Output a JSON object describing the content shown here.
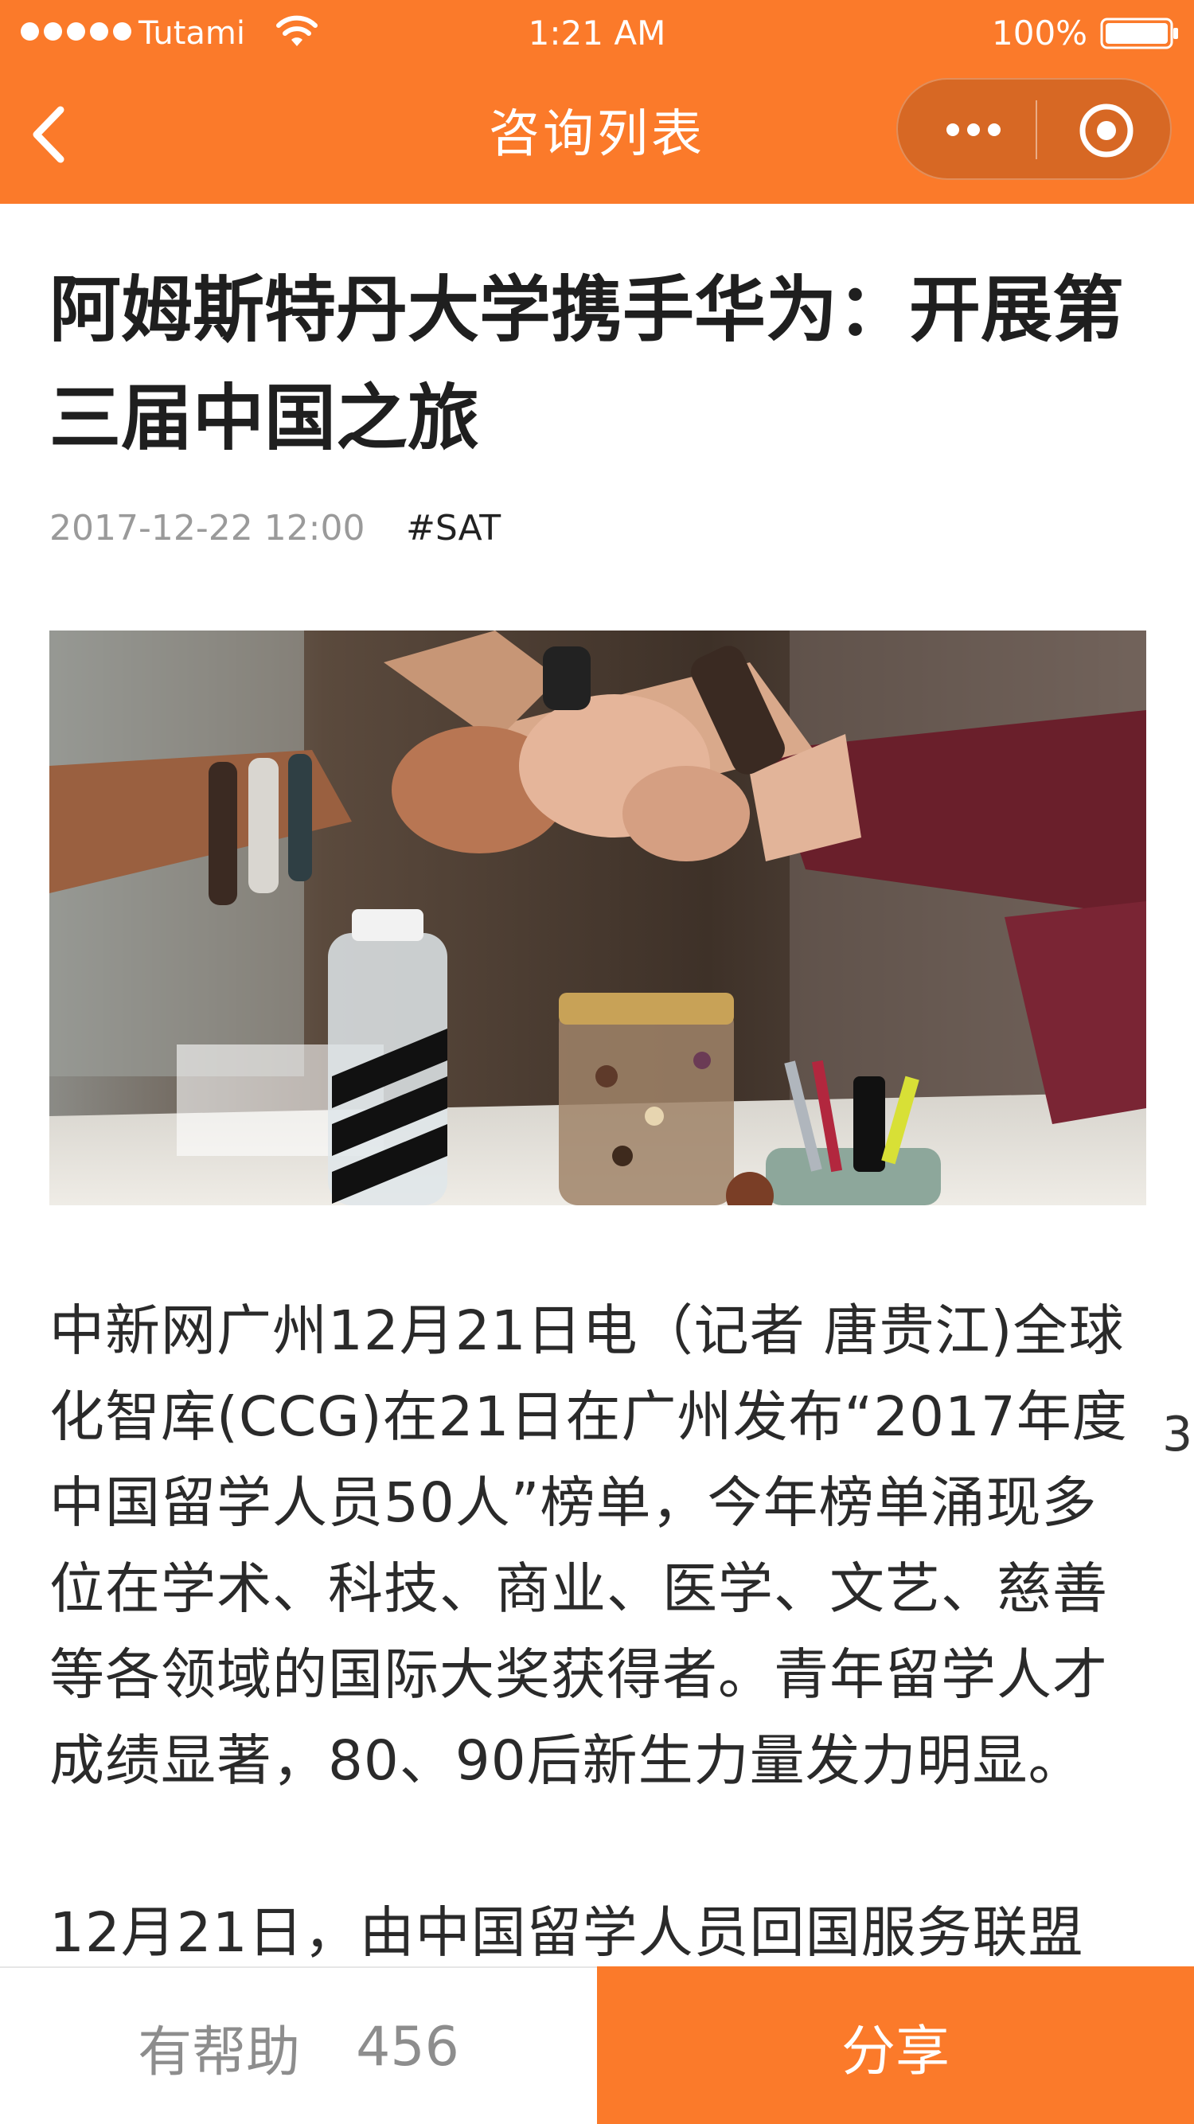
{
  "status_bar": {
    "carrier": "Tutami",
    "time": "1:21 AM",
    "battery": "100%"
  },
  "nav": {
    "title": "咨询列表",
    "back_icon": "chevron-left-icon",
    "more_icon": "more-dots-icon",
    "close_icon": "record-circle-icon"
  },
  "article": {
    "title": "阿姆斯特丹大学携手华为：开展第三届中国之旅",
    "date": "2017-12-22 12:00",
    "tag": "#SAT",
    "image_alt": "fist bump over a table",
    "paragraphs": [
      "中新网广州12月21日电（记者 唐贵江)全球化智库(CCG)在21日在广州发布“2017年度中国留学人员50人”榜单，今年榜单涌现多位在学术、科技、商业、医学、文艺、慈善等各领域的国际大奖获得者。青年留学人才成绩显著，80、90后新生力量发力明显。",
      "12月21日，由中国留学人员回国服务联盟"
    ],
    "side_digit": "3"
  },
  "bottom_bar": {
    "helpful_label": "有帮助",
    "helpful_count": "456",
    "share_label": "分享"
  },
  "colors": {
    "accent": "#fb7a2a"
  }
}
